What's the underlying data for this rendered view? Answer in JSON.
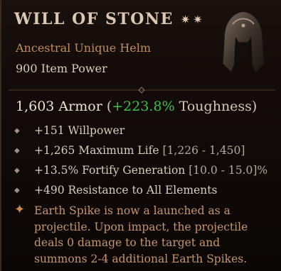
{
  "item": {
    "name": "WILL OF STONE",
    "stars": "✷✷",
    "type": "Ancestral Unique Helm",
    "power": "900 Item Power"
  },
  "armor": {
    "value": "1,603 Armor",
    "open": "(",
    "bonus": "+223.8%",
    "label": "Toughness)"
  },
  "affixes": [
    {
      "text": "+151 Willpower",
      "range": ""
    },
    {
      "text": "+1,265 Maximum Life",
      "range": "[1,226 - 1,450]"
    },
    {
      "text": "+13.5% Fortify Generation",
      "range": "[10.0 - 15.0]%"
    },
    {
      "text": "+490 Resistance to All Elements",
      "range": ""
    }
  ],
  "unique_effect": "Earth Spike is now a launched as a projectile. Upon impact, the projectile deals 0 damage to the target and summons 2-4 additional Earth Spikes.",
  "colors": {
    "unique_orange": "#c28b5a",
    "toughness_green": "#3fbf4a",
    "title": "#d9c9b2"
  }
}
